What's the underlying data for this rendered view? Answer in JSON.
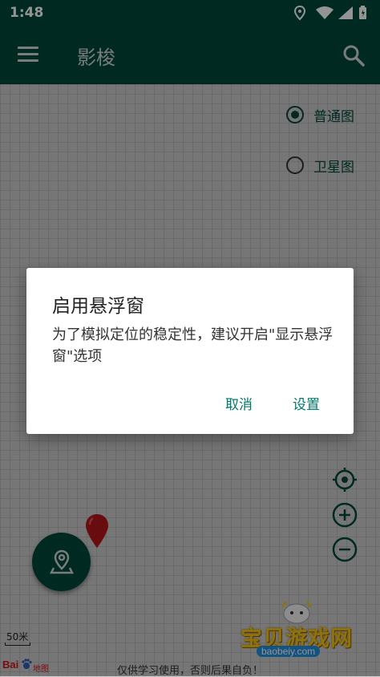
{
  "status_bar": {
    "time": "1:48"
  },
  "app_bar": {
    "title": "影梭"
  },
  "map": {
    "layers": [
      {
        "label": "普通图",
        "selected": true
      },
      {
        "label": "卫星图",
        "selected": false
      }
    ],
    "scale": "50米",
    "baidu_logo": "Bai",
    "baidu_sub": "地图",
    "disclaimer": "仅供学习使用，否则后果自负！"
  },
  "watermark": {
    "name": "宝贝游戏网",
    "url": "baobeiy.com"
  },
  "dialog": {
    "title": "启用悬浮窗",
    "message": "为了模拟定位的稳定性，建议开启\"显示悬浮窗\"选项",
    "cancel_label": "取消",
    "settings_label": "设置"
  },
  "colors": {
    "primary": "#00483c",
    "accent": "#007867",
    "marker": "#b5161a"
  },
  "icons": {
    "menu": "menu-icon",
    "search": "search-icon",
    "locate": "crosshair-icon",
    "zoom_in": "plus-circle-icon",
    "zoom_out": "minus-circle-icon",
    "fab": "location-pin-icon"
  }
}
